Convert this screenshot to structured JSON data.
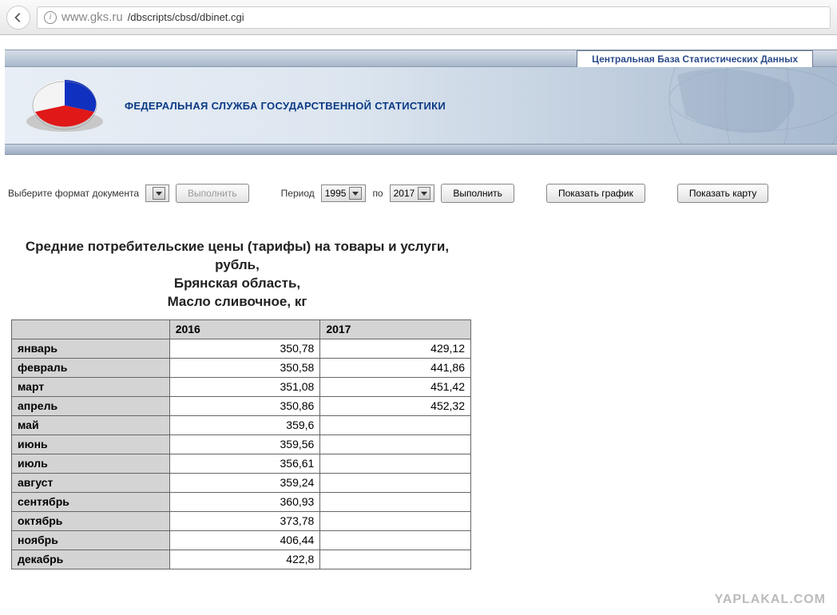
{
  "browser": {
    "url_host": "www.gks.ru",
    "url_path": "/dbscripts/cbsd/dbinet.cgi"
  },
  "banner": {
    "top_label": "Центральная База Статистических Данных",
    "org_name": "ФЕДЕРАЛЬНАЯ СЛУЖБА ГОСУДАРСТВЕННОЙ СТАТИСТИКИ"
  },
  "controls": {
    "format_label": "Выберите формат документа",
    "format_value": "",
    "execute_label": "Выполнить",
    "period_label": "Период",
    "period_from": "1995",
    "period_to_label": "по",
    "period_to": "2017",
    "execute2_label": "Выполнить",
    "show_chart_label": "Показать график",
    "show_map_label": "Показать карту"
  },
  "table": {
    "title_line1": "Средние потребительские цены (тарифы) на товары и услуги, рубль,",
    "title_line2": "Брянская область,",
    "title_line3": "Масло сливочное, кг",
    "years": [
      "2016",
      "2017"
    ],
    "rows": [
      {
        "label": "январь",
        "v2016": "350,78",
        "v2017": "429,12"
      },
      {
        "label": "февраль",
        "v2016": "350,58",
        "v2017": "441,86"
      },
      {
        "label": "март",
        "v2016": "351,08",
        "v2017": "451,42"
      },
      {
        "label": "апрель",
        "v2016": "350,86",
        "v2017": "452,32"
      },
      {
        "label": "май",
        "v2016": "359,6",
        "v2017": ""
      },
      {
        "label": "июнь",
        "v2016": "359,56",
        "v2017": ""
      },
      {
        "label": "июль",
        "v2016": "356,61",
        "v2017": ""
      },
      {
        "label": "август",
        "v2016": "359,24",
        "v2017": ""
      },
      {
        "label": "сентябрь",
        "v2016": "360,93",
        "v2017": ""
      },
      {
        "label": "октябрь",
        "v2016": "373,78",
        "v2017": ""
      },
      {
        "label": "ноябрь",
        "v2016": "406,44",
        "v2017": ""
      },
      {
        "label": "декабрь",
        "v2016": "422,8",
        "v2017": ""
      }
    ]
  },
  "watermark": "YAPLAKAL.COM"
}
